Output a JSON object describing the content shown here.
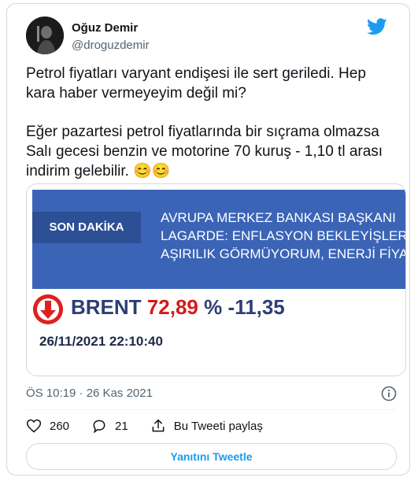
{
  "tweet": {
    "display_name": "Oğuz Demir",
    "handle": "@droguzdemir",
    "text_line1": "Petrol fiyatları varyant endişesi ile sert geriledi. Hep",
    "text_line2": "kara haber vermeyeyim değil mi?",
    "text_line3": "Eğer pazartesi petrol fiyatlarında bir sıçrama olmazsa",
    "text_line4": "Salı gecesi benzin ve motorine 70 kuruş - 1,10 tl arası",
    "text_line5": "indirim gelebilir. 😊😊",
    "timestamp": "ÖS 10:19 · 26 Kas 2021"
  },
  "media": {
    "tag": "SON DAKİKA",
    "headline_line1": "AVRUPA MERKEZ BANKASI BAŞKANI",
    "headline_line2": "LAGARDE: ENFLASYON BEKLEYİŞLERİNDE",
    "headline_line3": "AŞIRILIK GÖRMÜYORUM, ENERJİ FİYATLARI",
    "brent_label": "BRENT",
    "brent_value": "72,89",
    "brent_change": "% -11,35",
    "datetime": "26/11/2021 22:10:40",
    "banner_color": "#3b64b6",
    "down_color": "#e02020"
  },
  "actions": {
    "likes": "260",
    "replies": "21",
    "share_label": "Bu Tweeti paylaş",
    "reply_button": "Yanıtını Tweetle"
  },
  "colors": {
    "accent": "#1d9bf0",
    "secondary_text": "#536471"
  }
}
